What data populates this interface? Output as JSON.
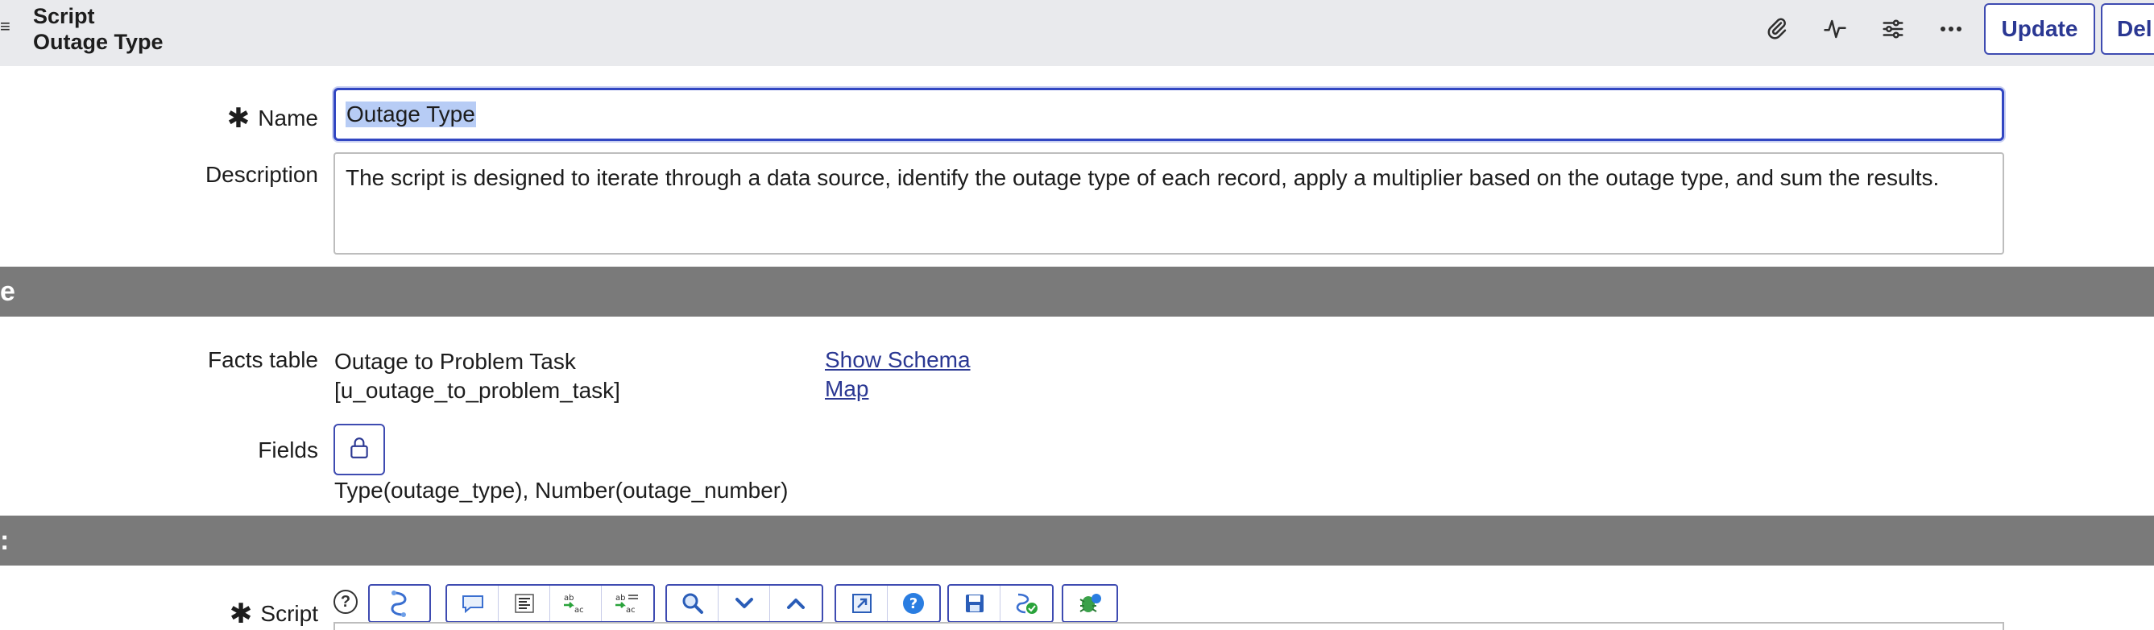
{
  "header": {
    "menu_icon": "hamburger-icon",
    "title_line1": "Script",
    "title_line2": "Outage Type",
    "icons": [
      "paperclip-icon",
      "activity-icon",
      "sliders-icon",
      "more-icon"
    ],
    "update_label": "Update",
    "delete_label": "Del"
  },
  "form": {
    "name_label": "Name",
    "name_value": "Outage Type",
    "description_label": "Description",
    "description_value": "The script is designed to iterate through a data source, identify the outage type of each record, apply a multiplier based on the outage type, and sum the results."
  },
  "sections": {
    "section1_label": "e",
    "section2_label": ":"
  },
  "facts": {
    "facts_label": "Facts table",
    "facts_value_line1": "Outage to Problem Task",
    "facts_value_line2": "[u_outage_to_problem_task]",
    "show_schema_label": "Show Schema",
    "map_label": "Map",
    "fields_label": "Fields",
    "fields_value": "Type(outage_type), Number(outage_number)"
  },
  "script": {
    "label": "Script",
    "help_glyph": "?",
    "toolbar_icons": [
      "script-include-icon",
      "comment-icon",
      "format-icon",
      "replace-icon",
      "replace-all-icon",
      "search-icon",
      "next-icon",
      "previous-icon",
      "fullscreen-icon",
      "help-icon",
      "save-icon",
      "toggle-syntax-icon",
      "debug-icon"
    ]
  },
  "colors": {
    "header_bg": "#e9eaed",
    "accent": "#3e4bb1",
    "section_bar": "#7a7a7a",
    "link": "#2b3893",
    "selection": "#b7ccf5"
  }
}
